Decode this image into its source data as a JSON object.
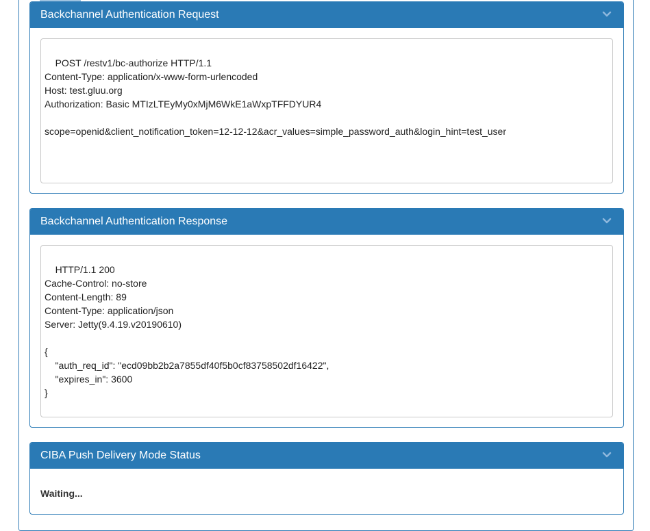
{
  "request_panel": {
    "title": "Backchannel Authentication Request",
    "body": "POST /restv1/bc-authorize HTTP/1.1\nContent-Type: application/x-www-form-urlencoded\nHost: test.gluu.org\nAuthorization: Basic MTIzLTEyMy0xMjM6WkE1aWxpTFFDYUR4\n\nscope=openid&client_notification_token=12-12-12&acr_values=simple_password_auth&login_hint=test_user"
  },
  "response_panel": {
    "title": "Backchannel Authentication Response",
    "body": "HTTP/1.1 200\nCache-Control: no-store\nContent-Length: 89\nContent-Type: application/json\nServer: Jetty(9.4.19.v20190610)\n\n{\n    \"auth_req_id\": \"ecd09bb2b2a7855df40f5b0cf83758502df16422\",\n    \"expires_in\": 3600\n}"
  },
  "status_panel": {
    "title": "CIBA Push Delivery Mode Status",
    "status": "Waiting..."
  },
  "icons": {
    "collapse": "chevron-down-icon",
    "resize": "resize-grip-icon"
  },
  "colors": {
    "panel_header": "#2a7ab5",
    "panel_border": "#2a7ab5",
    "chevron": "#8fb8dd"
  }
}
